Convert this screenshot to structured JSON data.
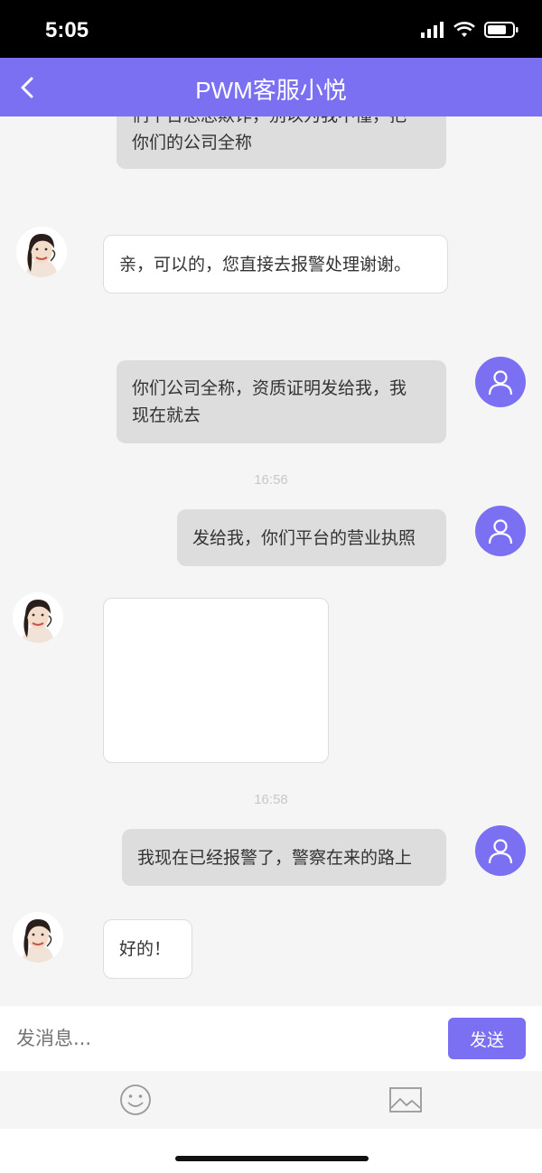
{
  "status_bar": {
    "time": "5:05"
  },
  "header": {
    "title": "PWM客服小悦"
  },
  "messages": {
    "m0_line1": "们平台总总欺诈，别以为我不懂，把",
    "m0_line2": "你们的公司全称",
    "m1": "亲，可以的，您直接去报警处理谢谢。",
    "m2_line1": "你们公司全称，资质证明发给我，我",
    "m2_line2": "现在就去",
    "t1": "16:56",
    "m3": "发给我，你们平台的营业执照",
    "t2": "16:58",
    "m4": "我现在已经报警了，警察在来的路上",
    "m5": "好的！"
  },
  "input": {
    "placeholder": "发消息..."
  },
  "send_label": "发送",
  "colors": {
    "accent": "#7b70f2",
    "out_bubble": "#dddddd",
    "in_bubble": "#ffffff"
  }
}
